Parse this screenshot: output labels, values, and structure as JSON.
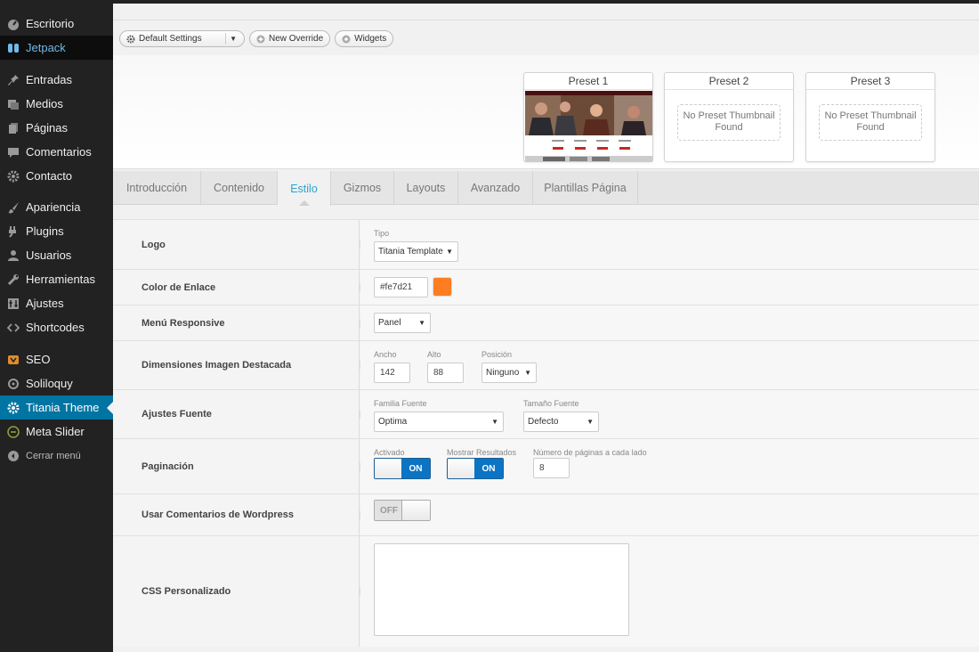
{
  "sidebar": {
    "items": [
      {
        "label": "Escritorio",
        "icon": "dashboard-icon"
      },
      {
        "label": "Jetpack",
        "icon": "jetpack-icon"
      },
      {
        "label": "Entradas",
        "icon": "pin-icon"
      },
      {
        "label": "Medios",
        "icon": "media-icon"
      },
      {
        "label": "Páginas",
        "icon": "pages-icon"
      },
      {
        "label": "Comentarios",
        "icon": "comments-icon"
      },
      {
        "label": "Contacto",
        "icon": "gear-icon"
      },
      {
        "label": "Apariencia",
        "icon": "brush-icon"
      },
      {
        "label": "Plugins",
        "icon": "plugin-icon"
      },
      {
        "label": "Usuarios",
        "icon": "user-icon"
      },
      {
        "label": "Herramientas",
        "icon": "wrench-icon"
      },
      {
        "label": "Ajustes",
        "icon": "settings-icon"
      },
      {
        "label": "Shortcodes",
        "icon": "code-icon"
      },
      {
        "label": "SEO",
        "icon": "seo-icon"
      },
      {
        "label": "Soliloquy",
        "icon": "soliloquy-icon"
      },
      {
        "label": "Titania Theme",
        "icon": "gear-icon"
      },
      {
        "label": "Meta Slider",
        "icon": "slider-icon"
      },
      {
        "label": "Cerrar menú",
        "icon": "collapse-icon"
      }
    ]
  },
  "toolbar": {
    "default_settings": "Default Settings",
    "new_override": "New Override",
    "widgets": "Widgets"
  },
  "presets": [
    {
      "title": "Preset 1",
      "thumbnail_text": ""
    },
    {
      "title": "Preset 2",
      "thumbnail_text": "No Preset Thumbnail Found"
    },
    {
      "title": "Preset 3",
      "thumbnail_text": "No Preset Thumbnail Found"
    }
  ],
  "tabs": [
    "Introducción",
    "Contenido",
    "Estilo",
    "Gizmos",
    "Layouts",
    "Avanzado",
    "Plantillas Página"
  ],
  "active_tab": "Estilo",
  "settings": {
    "logo": {
      "label": "Logo",
      "tipo_label": "Tipo",
      "tipo_value": "Titania Template"
    },
    "link_color": {
      "label": "Color de Enlace",
      "value": "#fe7d21",
      "swatch": "#fe7d21"
    },
    "responsive_menu": {
      "label": "Menú Responsive",
      "value": "Panel"
    },
    "featured_image": {
      "label": "Dimensiones Imagen Destacada",
      "ancho_label": "Ancho",
      "ancho_value": "142",
      "alto_label": "Alto",
      "alto_value": "88",
      "posicion_label": "Posición",
      "posicion_value": "Ninguno"
    },
    "fonts": {
      "label": "Ajustes Fuente",
      "family_label": "Familia Fuente",
      "family_value": "Optima",
      "size_label": "Tamaño Fuente",
      "size_value": "Defecto"
    },
    "pagination": {
      "label": "Paginación",
      "activado_label": "Activado",
      "activado_state": "ON",
      "mostrar_label": "Mostrar Resultados",
      "mostrar_state": "ON",
      "pages_label": "Número de páginas a cada lado",
      "pages_value": "8"
    },
    "wp_comments": {
      "label": "Usar Comentarios de Wordpress",
      "state": "OFF"
    },
    "custom_css": {
      "label": "CSS Personalizado",
      "value": ""
    }
  },
  "colors": {
    "accent": "#0074a2",
    "toggle_on": "#0b74c4",
    "link": "#fe7d21"
  }
}
